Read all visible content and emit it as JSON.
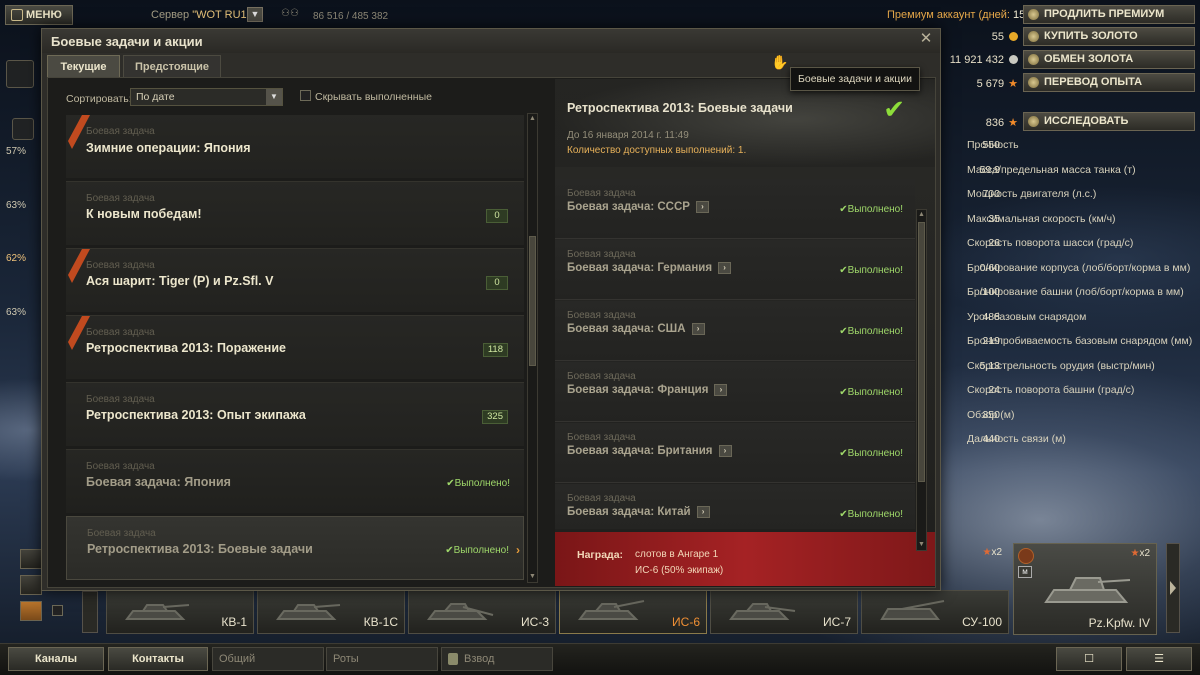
{
  "topbar": {
    "menu_label": "МЕНЮ",
    "server_label": "Сервер",
    "server_value": "\"WOT RU1\"",
    "online": "86 516 / 485 382",
    "premium_text": "Премиум аккаунт (дней:",
    "premium_days": "15)",
    "buttons": {
      "extend_premium": "ПРОДЛИТЬ ПРЕМИУМ",
      "buy_gold": "КУПИТЬ ЗОЛОТО",
      "exchange_gold": "ОБМЕН ЗОЛОТА",
      "transfer_xp": "ПЕРЕВОД ОПЫТА",
      "research": "ИССЛЕДОВАТЬ"
    },
    "gold": "55",
    "credits": "11 921 432",
    "free_xp": "5 679",
    "tank_xp": "836"
  },
  "stats": [
    {
      "value": "550",
      "label": "Прочность"
    },
    {
      "value": "59,9",
      "label": "Масса/предельная масса танка (т)"
    },
    {
      "value": "700",
      "label": "Мощность двигателя (л.с.)"
    },
    {
      "value": "35",
      "label": "Максимальная скорость (км/ч)"
    },
    {
      "value": "26",
      "label": "Скорость поворота шасси (град/с)"
    },
    {
      "value": "0/60",
      "label": "Бронирование корпуса (лоб/борт/корма в мм)"
    },
    {
      "value": "/100",
      "label": "Бронирование башни (лоб/борт/корма в мм)"
    },
    {
      "value": "488",
      "label": "Урон базовым снарядом"
    },
    {
      "value": "219",
      "label": "Бронепробиваемость базовым снарядом (мм)"
    },
    {
      "value": "5,13",
      "label": "Скорострельность орудия (выстр/мин)"
    },
    {
      "value": "24",
      "label": "Скорость поворота башни (град/с)"
    },
    {
      "value": "350",
      "label": "Обзор (м)"
    },
    {
      "value": "440",
      "label": "Дальность связи (м)"
    }
  ],
  "left_side": {
    "pcts": [
      "57%",
      "63%",
      "62%",
      "63%"
    ]
  },
  "dialog": {
    "title": "Боевые задачи и акции",
    "tabs": [
      "Текущие",
      "Предстоящие"
    ],
    "sort_label": "Сортировать:",
    "sort_value": "По дате",
    "hide_completed_label": "Скрывать выполненные",
    "quests": [
      {
        "type": "Боевая задача",
        "name": "Зимние операции: Япония",
        "count": "",
        "done": ""
      },
      {
        "type": "Боевая задача",
        "name": "К новым победам!",
        "count": "0",
        "done": ""
      },
      {
        "type": "Боевая задача",
        "name": "Ася шарит: Tiger (P) и Pz.Sfl. V",
        "count": "0",
        "done": ""
      },
      {
        "type": "Боевая задача",
        "name": "Ретроспектива 2013: Поражение",
        "count": "118",
        "done": ""
      },
      {
        "type": "Боевая задача",
        "name": "Ретроспектива 2013: Опыт экипажа",
        "count": "325",
        "done": ""
      },
      {
        "type": "Боевая задача",
        "name": "Боевая задача: Япония",
        "count": "",
        "done": "✔Выполнено!"
      },
      {
        "type": "Боевая задача",
        "name": "Ретроспектива 2013: Боевые задачи",
        "count": "",
        "done": "✔Выполнено!"
      }
    ],
    "detail": {
      "title": "Ретроспектива 2013: Боевые задачи",
      "date": "До 16 января 2014 г. 11:49",
      "available": "Количество доступных выполнений: 1.",
      "subquests": [
        {
          "type": "Боевая задача",
          "name": "Боевая задача: СССР",
          "done": "✔Выполнено!"
        },
        {
          "type": "Боевая задача",
          "name": "Боевая задача: Германия",
          "done": "✔Выполнено!"
        },
        {
          "type": "Боевая задача",
          "name": "Боевая задача: США",
          "done": "✔Выполнено!"
        },
        {
          "type": "Боевая задача",
          "name": "Боевая задача: Франция",
          "done": "✔Выполнено!"
        },
        {
          "type": "Боевая задача",
          "name": "Боевая задача: Британия",
          "done": "✔Выполнено!"
        },
        {
          "type": "Боевая задача",
          "name": "Боевая задача: Китай",
          "done": "✔Выполнено!"
        }
      ],
      "reward_label": "Награда:",
      "reward_line1": "слотов в Ангаре 1",
      "reward_line2": "ИС-6 (50% экипаж)"
    },
    "tooltip": "Боевые задачи и акции"
  },
  "carousel": {
    "tanks": [
      "КВ-1",
      "КВ-1С",
      "ИС-3",
      "ИС-6",
      "ИС-7",
      "СУ-100"
    ],
    "big_tank": "Pz.Kpfw. IV",
    "badge_su100": "x2",
    "badge_big": "x2"
  },
  "bottombar": {
    "channels": "Каналы",
    "contacts": "Контакты",
    "common": "Общий",
    "companies": "Роты",
    "platoon": "Взвод"
  },
  "colors": {
    "accent_orange": "#ef8f34",
    "done_green": "#9fd86a",
    "reward_red": "#a52224",
    "gold": "#e8a928"
  }
}
